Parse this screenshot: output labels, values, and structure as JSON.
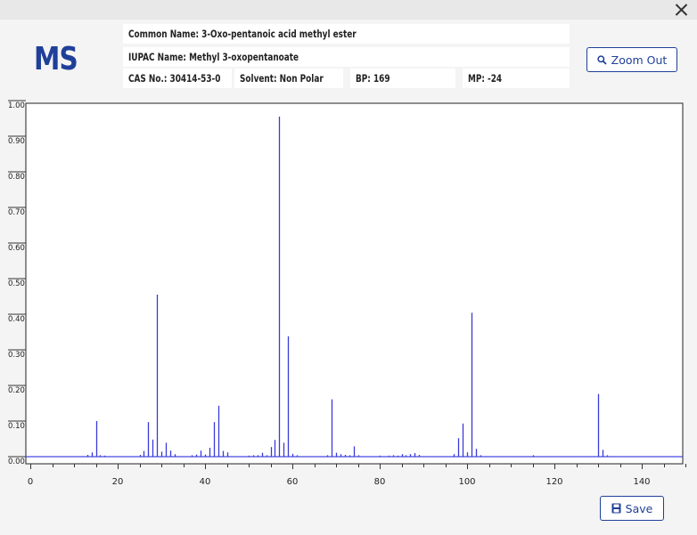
{
  "header": {
    "logo": "MS",
    "common_name": "Common Name: 3-Oxo-pentanoic acid methyl ester",
    "iupac_name": "IUPAC Name: Methyl 3-oxopentanoate",
    "cas": "CAS No.: 30414-53-0",
    "solvent": "Solvent: Non Polar",
    "bp": "BP: 169",
    "mp": "MP: -24"
  },
  "buttons": {
    "zoom_out": "Zoom Out",
    "save": "Save"
  },
  "icons": {
    "zoom": "magnifier-icon",
    "save": "floppy-disk-icon",
    "close": "close-icon"
  },
  "colors": {
    "accent": "#1f3f99",
    "peak": "#3a3ad8",
    "baseline": "#4848e0"
  },
  "chart_data": {
    "type": "bar",
    "title": "",
    "xlabel": "",
    "ylabel": "",
    "xlim": [
      0,
      150
    ],
    "ylim": [
      0,
      1.0
    ],
    "x_ticks": [
      0,
      20,
      40,
      60,
      80,
      100,
      120,
      140
    ],
    "y_ticks": [
      "0.00",
      "0.10",
      "0.20",
      "0.30",
      "0.40",
      "0.50",
      "0.60",
      "0.70",
      "0.80",
      "0.90",
      "1.00"
    ],
    "grid": false,
    "peaks": [
      {
        "x": 13,
        "y": 0.005
      },
      {
        "x": 14,
        "y": 0.012
      },
      {
        "x": 15,
        "y": 0.1
      },
      {
        "x": 16,
        "y": 0.004
      },
      {
        "x": 17,
        "y": 0.003
      },
      {
        "x": 25,
        "y": 0.005
      },
      {
        "x": 26,
        "y": 0.016
      },
      {
        "x": 27,
        "y": 0.097
      },
      {
        "x": 28,
        "y": 0.048
      },
      {
        "x": 29,
        "y": 0.455
      },
      {
        "x": 30,
        "y": 0.014
      },
      {
        "x": 31,
        "y": 0.039
      },
      {
        "x": 32,
        "y": 0.017
      },
      {
        "x": 33,
        "y": 0.007
      },
      {
        "x": 37,
        "y": 0.004
      },
      {
        "x": 38,
        "y": 0.006
      },
      {
        "x": 39,
        "y": 0.017
      },
      {
        "x": 40,
        "y": 0.006
      },
      {
        "x": 41,
        "y": 0.025
      },
      {
        "x": 42,
        "y": 0.097
      },
      {
        "x": 43,
        "y": 0.143
      },
      {
        "x": 44,
        "y": 0.016
      },
      {
        "x": 45,
        "y": 0.012
      },
      {
        "x": 50,
        "y": 0.003
      },
      {
        "x": 51,
        "y": 0.004
      },
      {
        "x": 52,
        "y": 0.004
      },
      {
        "x": 53,
        "y": 0.011
      },
      {
        "x": 54,
        "y": 0.004
      },
      {
        "x": 55,
        "y": 0.027
      },
      {
        "x": 56,
        "y": 0.047
      },
      {
        "x": 57,
        "y": 0.955
      },
      {
        "x": 58,
        "y": 0.039
      },
      {
        "x": 59,
        "y": 0.338
      },
      {
        "x": 60,
        "y": 0.008
      },
      {
        "x": 61,
        "y": 0.004
      },
      {
        "x": 68,
        "y": 0.004
      },
      {
        "x": 69,
        "y": 0.161
      },
      {
        "x": 70,
        "y": 0.011
      },
      {
        "x": 71,
        "y": 0.007
      },
      {
        "x": 72,
        "y": 0.005
      },
      {
        "x": 73,
        "y": 0.004
      },
      {
        "x": 74,
        "y": 0.029
      },
      {
        "x": 75,
        "y": 0.004
      },
      {
        "x": 80,
        "y": 0.003
      },
      {
        "x": 82,
        "y": 0.003
      },
      {
        "x": 83,
        "y": 0.004
      },
      {
        "x": 84,
        "y": 0.003
      },
      {
        "x": 85,
        "y": 0.007
      },
      {
        "x": 86,
        "y": 0.004
      },
      {
        "x": 87,
        "y": 0.007
      },
      {
        "x": 88,
        "y": 0.01
      },
      {
        "x": 89,
        "y": 0.005
      },
      {
        "x": 97,
        "y": 0.007
      },
      {
        "x": 98,
        "y": 0.052
      },
      {
        "x": 99,
        "y": 0.093
      },
      {
        "x": 100,
        "y": 0.012
      },
      {
        "x": 101,
        "y": 0.404
      },
      {
        "x": 102,
        "y": 0.022
      },
      {
        "x": 103,
        "y": 0.004
      },
      {
        "x": 115,
        "y": 0.004
      },
      {
        "x": 130,
        "y": 0.176
      },
      {
        "x": 131,
        "y": 0.019
      },
      {
        "x": 132,
        "y": 0.004
      }
    ]
  }
}
